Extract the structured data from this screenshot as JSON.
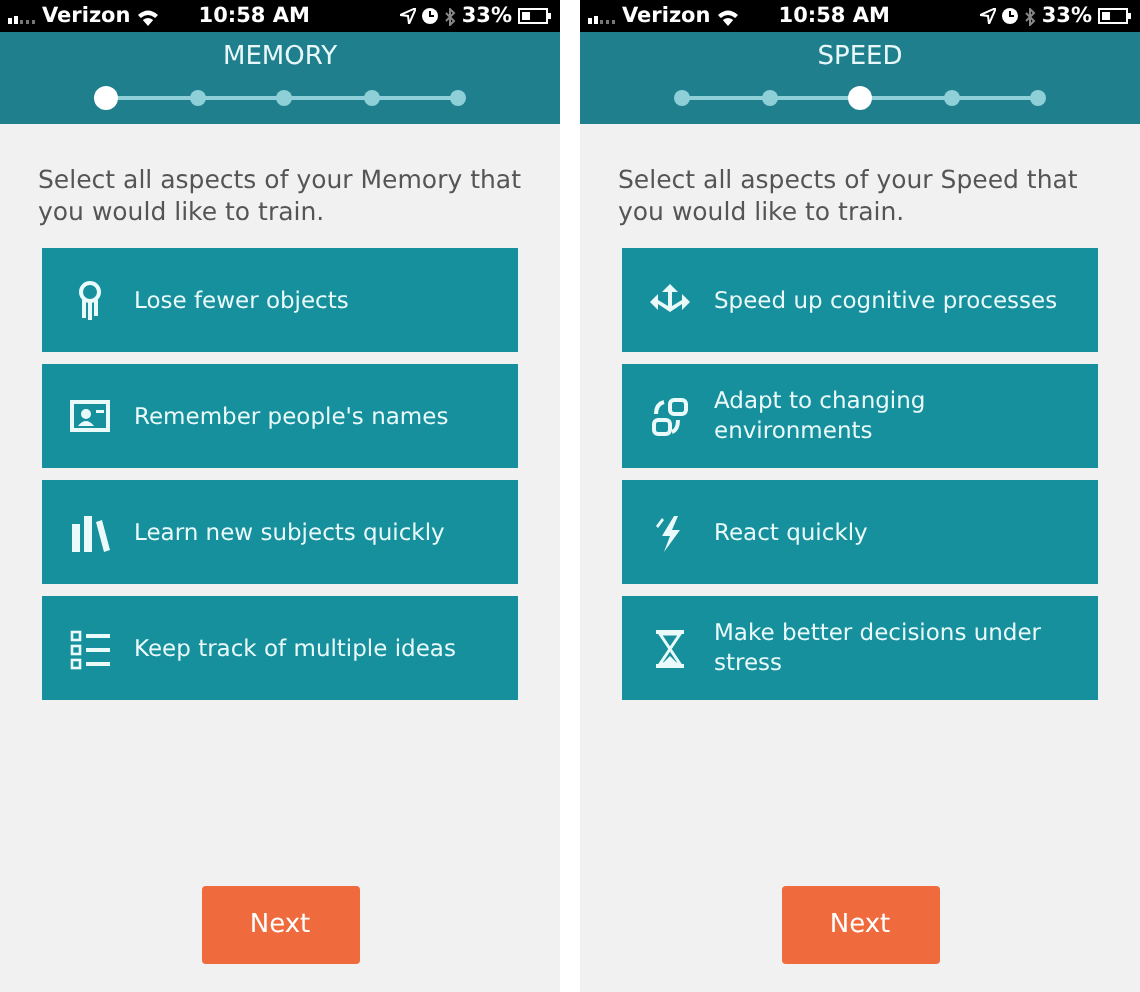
{
  "screens": [
    {
      "status_bar": {
        "carrier": "Verizon",
        "time": "10:58 AM",
        "battery": "33%"
      },
      "title": "MEMORY",
      "steps": [
        {
          "selected": true
        },
        {
          "selected": false
        },
        {
          "selected": false
        },
        {
          "selected": false
        },
        {
          "selected": false
        }
      ],
      "prompt": "Select all aspects of your Memory that you would like to train.",
      "options": [
        {
          "label": "Lose fewer objects"
        },
        {
          "label": "Remember people's names"
        },
        {
          "label": "Learn new subjects quickly"
        },
        {
          "label": "Keep track of multiple ideas"
        }
      ],
      "next_button": "Next"
    },
    {
      "status_bar": {
        "carrier": "Verizon",
        "time": "10:58 AM",
        "battery": "33%"
      },
      "title": "SPEED",
      "steps": [
        {
          "selected": false
        },
        {
          "selected": false
        },
        {
          "selected": true
        },
        {
          "selected": false
        },
        {
          "selected": false
        }
      ],
      "prompt": "Select all aspects of your Speed that you would like to train.",
      "options": [
        {
          "label": "Speed up cognitive processes"
        },
        {
          "label": "Adapt to changing environments"
        },
        {
          "label": "React quickly"
        },
        {
          "label": "Make better decisions under stress"
        }
      ],
      "next_button": "Next"
    }
  ]
}
